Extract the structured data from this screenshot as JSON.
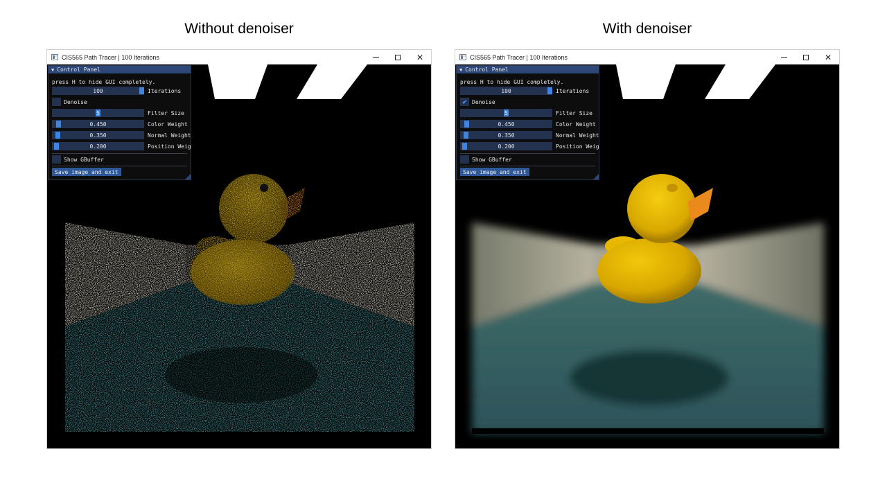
{
  "captions": {
    "left": "Without denoiser",
    "right": "With denoiser"
  },
  "windows": [
    {
      "title": "CIS565 Path Tracer | 100 Iterations",
      "icon": "app-window-icon",
      "controls": [
        "minimize-icon",
        "maximize-icon",
        "close-icon"
      ],
      "panel": {
        "header": "Control Panel",
        "hint": "press H to hide GUI completely.",
        "iterations": {
          "value": "100",
          "label": "Iterations",
          "fraction": 1.0
        },
        "denoise": {
          "label": "Denoise",
          "checked": false
        },
        "filter_size": {
          "value": "5",
          "label": "Filter Size",
          "fraction": 0.5
        },
        "color_weight": {
          "value": "0.450",
          "label": "Color Weight",
          "fraction": 0.05
        },
        "normal_weight": {
          "value": "0.350",
          "label": "Normal Weight",
          "fraction": 0.04
        },
        "position_weight": {
          "value": "0.200",
          "label": "Position Weig",
          "fraction": 0.02
        },
        "show_gbuffer": {
          "label": "Show GBuffer",
          "checked": false
        },
        "save_button": "Save image and exit"
      },
      "render": {
        "denoised": false
      }
    },
    {
      "title": "CIS565 Path Tracer | 100 Iterations",
      "icon": "app-window-icon",
      "controls": [
        "minimize-icon",
        "maximize-icon",
        "close-icon"
      ],
      "panel": {
        "header": "Control Panel",
        "hint": "press H to hide GUI completely.",
        "iterations": {
          "value": "100",
          "label": "Iterations",
          "fraction": 1.0
        },
        "denoise": {
          "label": "Denoise",
          "checked": true
        },
        "filter_size": {
          "value": "5",
          "label": "Filter Size",
          "fraction": 0.5
        },
        "color_weight": {
          "value": "0.450",
          "label": "Color Weight",
          "fraction": 0.05
        },
        "normal_weight": {
          "value": "0.350",
          "label": "Normal Weight",
          "fraction": 0.04
        },
        "position_weight": {
          "value": "0.200",
          "label": "Position Weig",
          "fraction": 0.02
        },
        "show_gbuffer": {
          "label": "Show GBuffer",
          "checked": false
        },
        "save_button": "Save image and exit"
      },
      "render": {
        "denoised": true
      }
    }
  ],
  "colors": {
    "panel_header": "#2c4778",
    "slider_bg": "#22324f",
    "slider_grab": "#3d85e0",
    "button": "#2e5798",
    "duck": "#e0b400",
    "beak": "#e8801a",
    "floor": "#2f5f63",
    "wall": "#c9c4b4"
  }
}
